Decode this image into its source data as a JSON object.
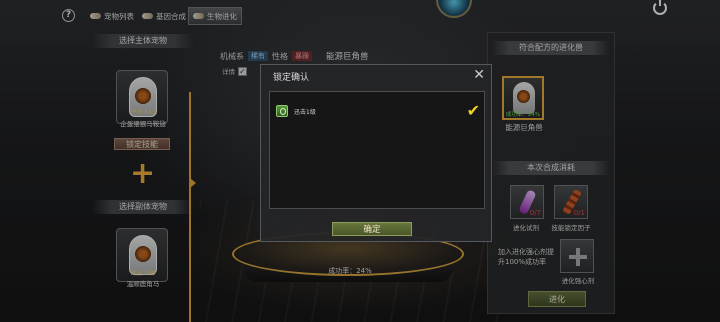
{
  "tabs": [
    {
      "label": "宠物列表",
      "active": false
    },
    {
      "label": "基因合成",
      "active": false
    },
    {
      "label": "生物进化",
      "active": true
    }
  ],
  "left": {
    "main_pet_header": "选择主体宠物",
    "main_pet": {
      "score": "评分:813",
      "name": "企蛋猥猥马鞍翅"
    },
    "lock_skill_label": "锁定技能",
    "secondary_pet_header": "选择副体宠物",
    "secondary_pet": {
      "score": "评分:599",
      "name": "温顺鹿角马"
    }
  },
  "middle": {
    "tag1": "机械系",
    "tag2": "稀有",
    "tag3": "性格",
    "tag4": "暴躁",
    "beast_name": "能源巨角兽",
    "details_label": "详情",
    "success_rate": "成功率：24%"
  },
  "modal": {
    "title": "锁定确认",
    "close_icon": "close-icon",
    "skill_label": "迅击1级",
    "confirm_label": "确定"
  },
  "right": {
    "recipe_header": "符合配方的进化兽",
    "beast_rate": "成功率：24%",
    "beast_name": "能源巨角兽",
    "consume_header": "本次合成消耗",
    "items": [
      {
        "qty": "0/7",
        "label": "进化试剂"
      },
      {
        "qty": "0/1",
        "label": "技能锁定因子"
      }
    ],
    "add_hint": "加入进化强心剂提升100%成功率",
    "booster_label": "进化强心剂",
    "evolve_label": "进化"
  },
  "colors": {
    "accent": "#d59a36",
    "success": "#6fd34f",
    "qty_red": "#e04040",
    "check": "#f0d21c"
  }
}
